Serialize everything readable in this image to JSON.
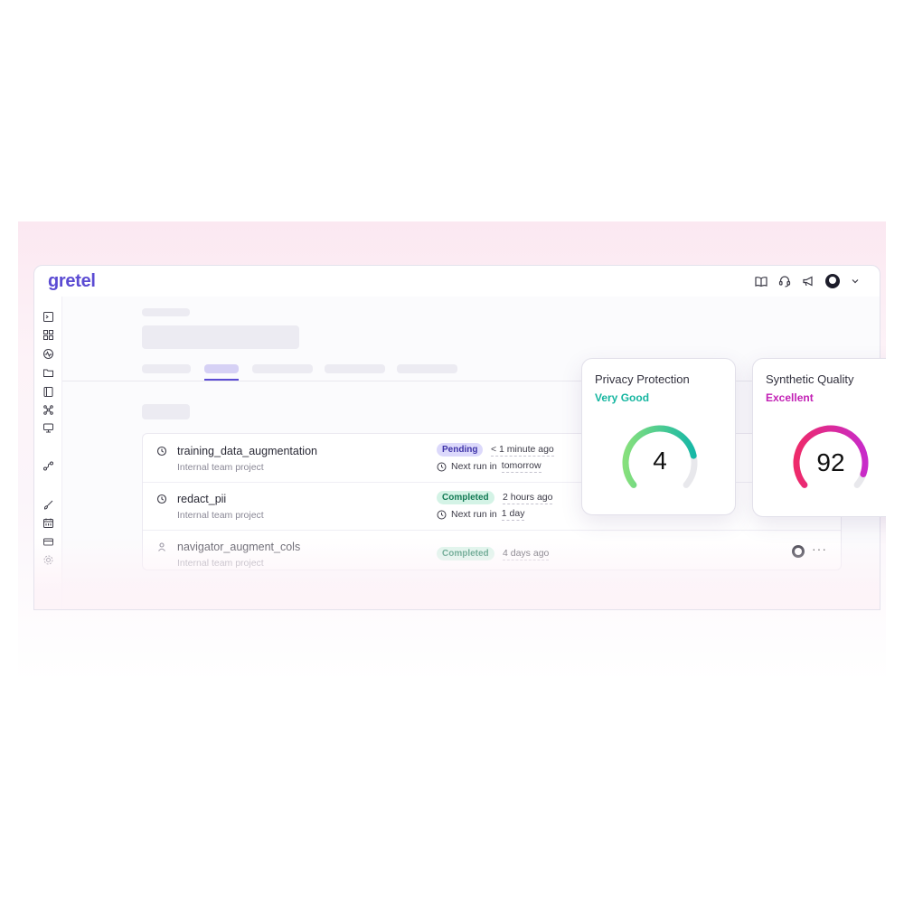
{
  "app": {
    "logo": "gretel"
  },
  "topbar": {
    "icons": [
      "book-icon",
      "headset-icon",
      "megaphone-icon",
      "avatar",
      "chevron-down-icon"
    ]
  },
  "sidebar": {
    "icons": [
      "terminal-icon",
      "grid-icon",
      "activity-icon",
      "folder-icon",
      "notebook-icon",
      "network-icon",
      "monitor-icon",
      "route-icon",
      "brush-icon",
      "calendar-icon",
      "card-icon",
      "settings-icon"
    ]
  },
  "workflows": [
    {
      "name": "training_data_augmentation",
      "project": "Internal team project",
      "status": "Pending",
      "status_time": "< 1 minute ago",
      "next_run_prefix": "Next run in",
      "next_run_value": "tomorrow"
    },
    {
      "name": "redact_pii",
      "project": "Internal team project",
      "status": "Completed",
      "status_time": "2 hours ago",
      "next_run_prefix": "Next run in",
      "next_run_value": "1 day"
    },
    {
      "name": "navigator_augment_cols",
      "project": "Internal team project",
      "status": "Completed",
      "status_time": "4 days ago",
      "more": "···"
    }
  ],
  "cards": [
    {
      "title": "Privacy Protection",
      "rating": "Very Good",
      "rating_color": "#16b6a0",
      "score": "4",
      "fraction": 0.8,
      "gradient": [
        "#86e07c",
        "#17b8a6"
      ]
    },
    {
      "title": "Synthetic Quality",
      "rating": "Excellent",
      "rating_color": "#c21fb4",
      "score": "92",
      "fraction": 0.92,
      "gradient": [
        "#ee2a6a",
        "#c82bc9"
      ]
    }
  ]
}
